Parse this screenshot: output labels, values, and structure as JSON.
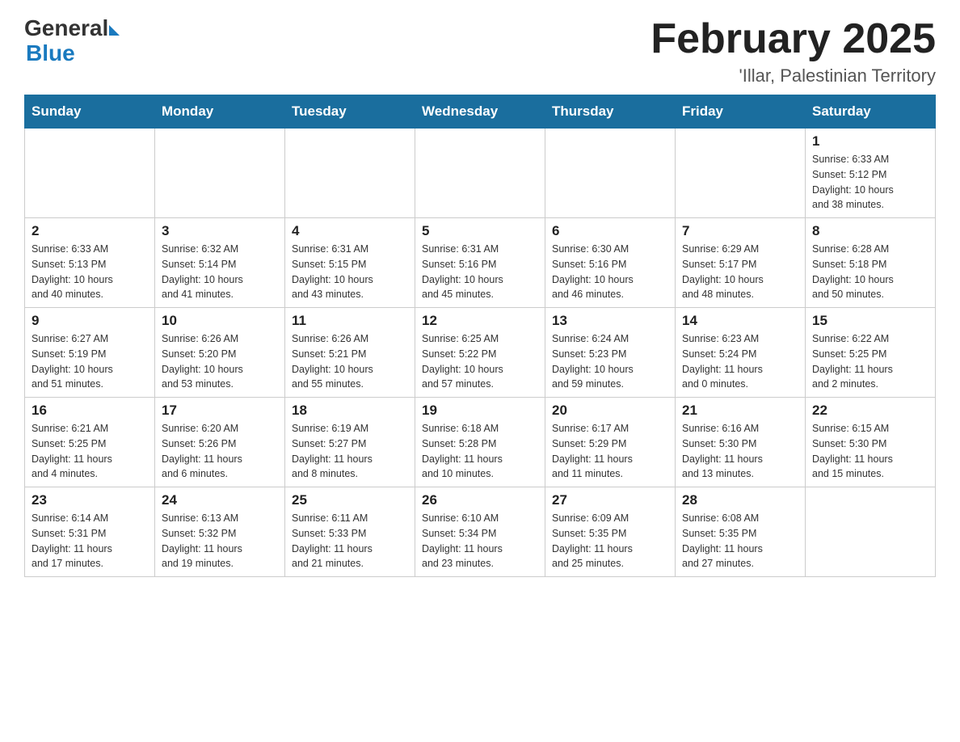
{
  "header": {
    "logo_general": "General",
    "logo_blue": "Blue",
    "title": "February 2025",
    "subtitle": "'Illar, Palestinian Territory"
  },
  "weekdays": [
    "Sunday",
    "Monday",
    "Tuesday",
    "Wednesday",
    "Thursday",
    "Friday",
    "Saturday"
  ],
  "weeks": [
    {
      "days": [
        {
          "num": "",
          "info": ""
        },
        {
          "num": "",
          "info": ""
        },
        {
          "num": "",
          "info": ""
        },
        {
          "num": "",
          "info": ""
        },
        {
          "num": "",
          "info": ""
        },
        {
          "num": "",
          "info": ""
        },
        {
          "num": "1",
          "info": "Sunrise: 6:33 AM\nSunset: 5:12 PM\nDaylight: 10 hours\nand 38 minutes."
        }
      ]
    },
    {
      "days": [
        {
          "num": "2",
          "info": "Sunrise: 6:33 AM\nSunset: 5:13 PM\nDaylight: 10 hours\nand 40 minutes."
        },
        {
          "num": "3",
          "info": "Sunrise: 6:32 AM\nSunset: 5:14 PM\nDaylight: 10 hours\nand 41 minutes."
        },
        {
          "num": "4",
          "info": "Sunrise: 6:31 AM\nSunset: 5:15 PM\nDaylight: 10 hours\nand 43 minutes."
        },
        {
          "num": "5",
          "info": "Sunrise: 6:31 AM\nSunset: 5:16 PM\nDaylight: 10 hours\nand 45 minutes."
        },
        {
          "num": "6",
          "info": "Sunrise: 6:30 AM\nSunset: 5:16 PM\nDaylight: 10 hours\nand 46 minutes."
        },
        {
          "num": "7",
          "info": "Sunrise: 6:29 AM\nSunset: 5:17 PM\nDaylight: 10 hours\nand 48 minutes."
        },
        {
          "num": "8",
          "info": "Sunrise: 6:28 AM\nSunset: 5:18 PM\nDaylight: 10 hours\nand 50 minutes."
        }
      ]
    },
    {
      "days": [
        {
          "num": "9",
          "info": "Sunrise: 6:27 AM\nSunset: 5:19 PM\nDaylight: 10 hours\nand 51 minutes."
        },
        {
          "num": "10",
          "info": "Sunrise: 6:26 AM\nSunset: 5:20 PM\nDaylight: 10 hours\nand 53 minutes."
        },
        {
          "num": "11",
          "info": "Sunrise: 6:26 AM\nSunset: 5:21 PM\nDaylight: 10 hours\nand 55 minutes."
        },
        {
          "num": "12",
          "info": "Sunrise: 6:25 AM\nSunset: 5:22 PM\nDaylight: 10 hours\nand 57 minutes."
        },
        {
          "num": "13",
          "info": "Sunrise: 6:24 AM\nSunset: 5:23 PM\nDaylight: 10 hours\nand 59 minutes."
        },
        {
          "num": "14",
          "info": "Sunrise: 6:23 AM\nSunset: 5:24 PM\nDaylight: 11 hours\nand 0 minutes."
        },
        {
          "num": "15",
          "info": "Sunrise: 6:22 AM\nSunset: 5:25 PM\nDaylight: 11 hours\nand 2 minutes."
        }
      ]
    },
    {
      "days": [
        {
          "num": "16",
          "info": "Sunrise: 6:21 AM\nSunset: 5:25 PM\nDaylight: 11 hours\nand 4 minutes."
        },
        {
          "num": "17",
          "info": "Sunrise: 6:20 AM\nSunset: 5:26 PM\nDaylight: 11 hours\nand 6 minutes."
        },
        {
          "num": "18",
          "info": "Sunrise: 6:19 AM\nSunset: 5:27 PM\nDaylight: 11 hours\nand 8 minutes."
        },
        {
          "num": "19",
          "info": "Sunrise: 6:18 AM\nSunset: 5:28 PM\nDaylight: 11 hours\nand 10 minutes."
        },
        {
          "num": "20",
          "info": "Sunrise: 6:17 AM\nSunset: 5:29 PM\nDaylight: 11 hours\nand 11 minutes."
        },
        {
          "num": "21",
          "info": "Sunrise: 6:16 AM\nSunset: 5:30 PM\nDaylight: 11 hours\nand 13 minutes."
        },
        {
          "num": "22",
          "info": "Sunrise: 6:15 AM\nSunset: 5:30 PM\nDaylight: 11 hours\nand 15 minutes."
        }
      ]
    },
    {
      "days": [
        {
          "num": "23",
          "info": "Sunrise: 6:14 AM\nSunset: 5:31 PM\nDaylight: 11 hours\nand 17 minutes."
        },
        {
          "num": "24",
          "info": "Sunrise: 6:13 AM\nSunset: 5:32 PM\nDaylight: 11 hours\nand 19 minutes."
        },
        {
          "num": "25",
          "info": "Sunrise: 6:11 AM\nSunset: 5:33 PM\nDaylight: 11 hours\nand 21 minutes."
        },
        {
          "num": "26",
          "info": "Sunrise: 6:10 AM\nSunset: 5:34 PM\nDaylight: 11 hours\nand 23 minutes."
        },
        {
          "num": "27",
          "info": "Sunrise: 6:09 AM\nSunset: 5:35 PM\nDaylight: 11 hours\nand 25 minutes."
        },
        {
          "num": "28",
          "info": "Sunrise: 6:08 AM\nSunset: 5:35 PM\nDaylight: 11 hours\nand 27 minutes."
        },
        {
          "num": "",
          "info": ""
        }
      ]
    }
  ]
}
